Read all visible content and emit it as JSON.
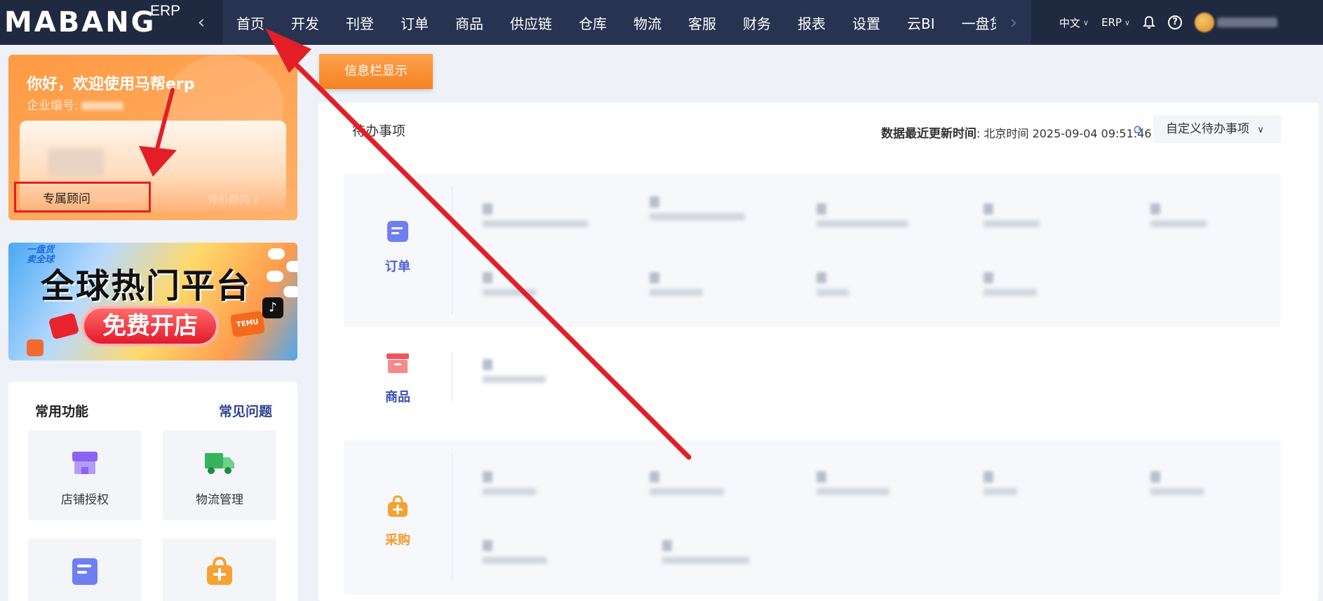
{
  "topbar": {
    "logo_text": "MABANG",
    "logo_suffix": "ERP",
    "nav_items": [
      "首页",
      "开发",
      "刊登",
      "订单",
      "商品",
      "供应链",
      "仓库",
      "物流",
      "客服",
      "财务",
      "报表",
      "设置",
      "云BI",
      "一盘货卖全"
    ],
    "language": "中文",
    "product_switch": "ERP"
  },
  "welcome": {
    "title": "你好，欢迎使用马帮erp",
    "company_label": "企业编号:",
    "advisor_label": "专属顾问",
    "rate_advisor": "评价顾问 》"
  },
  "banner": {
    "tag": "一盘货\n卖全球",
    "title": "全球热门平台",
    "cta": "免费开店",
    "temu_label": "TEMU"
  },
  "common_functions": {
    "title": "常用功能",
    "faq": "常见问题",
    "tiles": [
      {
        "label": "店铺授权",
        "icon": "store-icon",
        "color": "#8a63f5"
      },
      {
        "label": "物流管理",
        "icon": "truck-icon",
        "color": "#37b45b"
      },
      {
        "label": "",
        "icon": "order-doc-icon",
        "color": "#6f7ff2"
      },
      {
        "label": "",
        "icon": "purchase-bag-icon",
        "color": "#f5a233"
      }
    ]
  },
  "main": {
    "info_button": "信息栏显示",
    "todo_title": "待办事项",
    "update_label": "数据最近更新时间",
    "update_value": ": 北京时间 2025-09-04 09:51:46",
    "custom_button": "自定义待办事项",
    "sections": [
      {
        "label": "订单",
        "color": "#4f5fd3",
        "icon_color": "#6f7ff2"
      },
      {
        "label": "商品",
        "color": "#3d4fb5",
        "icon_color": "#f0555b"
      },
      {
        "label": "采购",
        "color": "#f59a2a",
        "icon_color": "#f5a233"
      }
    ]
  },
  "colors": {
    "nav_bg": "#1f2a40",
    "accent_orange": "#f48222",
    "annotation_red": "#e41e26"
  }
}
